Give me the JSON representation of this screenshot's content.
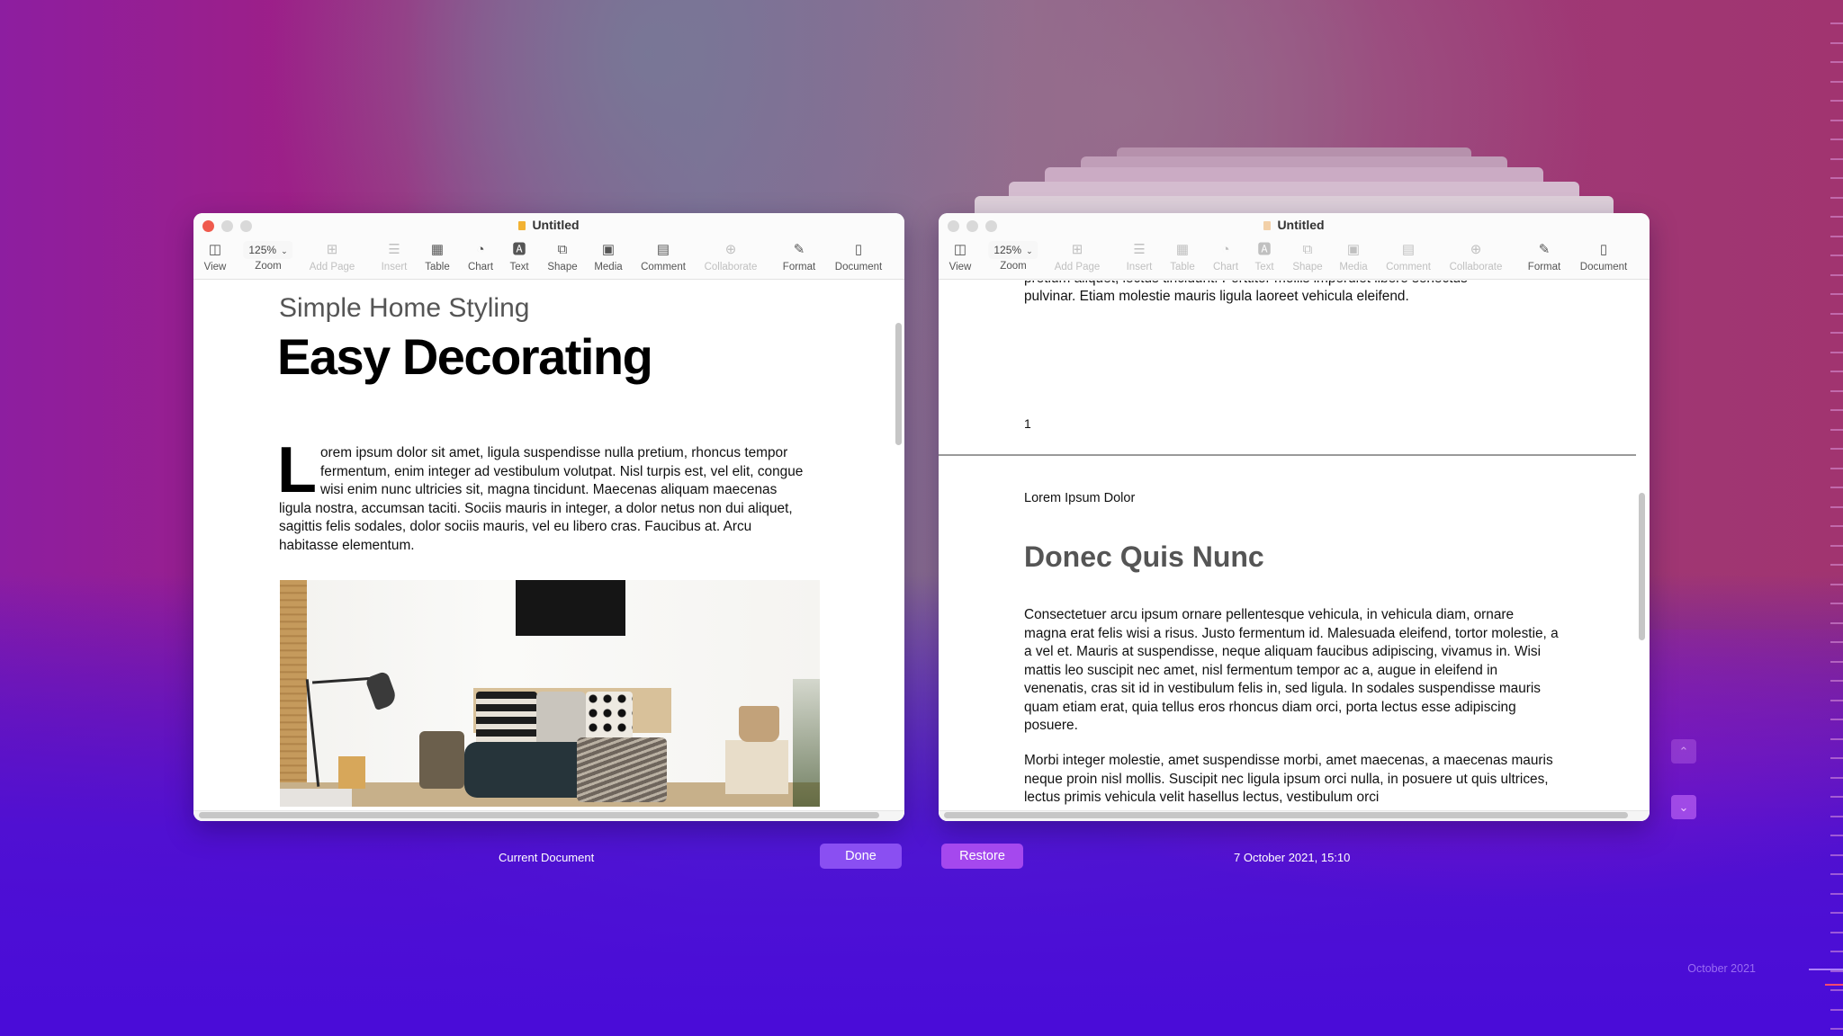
{
  "windows": {
    "current": {
      "title": "Untitled",
      "zoom_value": "125%",
      "toolbar": [
        {
          "id": "view",
          "label": "View",
          "icon": "sidebar-icon",
          "glyph": "◫",
          "enabled": true
        },
        {
          "id": "zoom",
          "label": "Zoom",
          "icon": "zoom-dropdown",
          "glyph": "",
          "enabled": true
        },
        {
          "id": "add-page",
          "label": "Add Page",
          "icon": "add-page-icon",
          "glyph": "⊞",
          "enabled": false
        },
        {
          "id": "insert",
          "label": "Insert",
          "icon": "insert-icon",
          "glyph": "☰",
          "enabled": false
        },
        {
          "id": "table",
          "label": "Table",
          "icon": "table-icon",
          "glyph": "▦",
          "enabled": true
        },
        {
          "id": "chart",
          "label": "Chart",
          "icon": "chart-icon",
          "glyph": "◔",
          "enabled": true
        },
        {
          "id": "text",
          "label": "Text",
          "icon": "text-box-icon",
          "glyph": "🅰",
          "enabled": true
        },
        {
          "id": "shape",
          "label": "Shape",
          "icon": "shape-icon",
          "glyph": "⧉",
          "enabled": true
        },
        {
          "id": "media",
          "label": "Media",
          "icon": "media-icon",
          "glyph": "▣",
          "enabled": true
        },
        {
          "id": "comment",
          "label": "Comment",
          "icon": "comment-icon",
          "glyph": "▤",
          "enabled": true
        },
        {
          "id": "collaborate",
          "label": "Collaborate",
          "icon": "collaborate-icon",
          "glyph": "⊕",
          "enabled": false
        },
        {
          "id": "format",
          "label": "Format",
          "icon": "format-brush-icon",
          "glyph": "✎",
          "enabled": true
        },
        {
          "id": "document",
          "label": "Document",
          "icon": "document-icon",
          "glyph": "▯",
          "enabled": true
        }
      ],
      "subtitle": "Simple Home Styling",
      "headline": "Easy Decorating",
      "dropcap": "L",
      "paragraph": "orem ipsum dolor sit amet, ligula suspendisse nulla pretium, rhoncus tempor fermentum, enim integer ad vestibulum volutpat. Nisl turpis est, vel elit, congue wisi enim nunc ultricies sit, magna tincidunt. Maecenas aliquam maecenas ligula nostra, accumsan taciti. Sociis mauris in integer, a dolor netus non dui aliquet, sagittis felis sodales, dolor sociis mauris, vel eu libero cras. Faucibus at. Arcu habitasse elementum.",
      "image_alt": "Living room with floor lamp, cushions and baskets"
    },
    "version": {
      "title": "Untitled",
      "zoom_value": "125%",
      "toolbar": [
        {
          "id": "view",
          "label": "View",
          "icon": "sidebar-icon",
          "glyph": "◫",
          "enabled": true
        },
        {
          "id": "zoom",
          "label": "Zoom",
          "icon": "zoom-dropdown",
          "glyph": "",
          "enabled": true
        },
        {
          "id": "add-page",
          "label": "Add Page",
          "icon": "add-page-icon",
          "glyph": "⊞",
          "enabled": false
        },
        {
          "id": "insert",
          "label": "Insert",
          "icon": "insert-icon",
          "glyph": "☰",
          "enabled": false
        },
        {
          "id": "table",
          "label": "Table",
          "icon": "table-icon",
          "glyph": "▦",
          "enabled": false
        },
        {
          "id": "chart",
          "label": "Chart",
          "icon": "chart-icon",
          "glyph": "◔",
          "enabled": false
        },
        {
          "id": "text",
          "label": "Text",
          "icon": "text-box-icon",
          "glyph": "🅰",
          "enabled": false
        },
        {
          "id": "shape",
          "label": "Shape",
          "icon": "shape-icon",
          "glyph": "⧉",
          "enabled": false
        },
        {
          "id": "media",
          "label": "Media",
          "icon": "media-icon",
          "glyph": "▣",
          "enabled": false
        },
        {
          "id": "comment",
          "label": "Comment",
          "icon": "comment-icon",
          "glyph": "▤",
          "enabled": false
        },
        {
          "id": "collaborate",
          "label": "Collaborate",
          "icon": "collaborate-icon",
          "glyph": "⊕",
          "enabled": false
        },
        {
          "id": "format",
          "label": "Format",
          "icon": "format-brush-icon",
          "glyph": "✎",
          "enabled": true
        },
        {
          "id": "document",
          "label": "Document",
          "icon": "document-icon",
          "glyph": "▯",
          "enabled": true
        }
      ],
      "partial_top_line": "pretium aliquet, lectus tincidunt. Porttitor mollis imperdiet libero senectus",
      "top_line": "pulvinar. Etiam molestie mauris ligula laoreet vehicula eleifend.",
      "page_number": "1",
      "header_text": "Lorem Ipsum Dolor",
      "section_title": "Donec Quis Nunc",
      "paragraph1": "Consectetuer arcu ipsum ornare pellentesque vehicula, in vehicula diam, ornare magna erat felis wisi a risus. Justo fermentum id. Malesuada eleifend, tortor molestie, a a vel et. Mauris at suspendisse, neque aliquam faucibus adipiscing, vivamus in. Wisi mattis leo suscipit nec amet, nisl fermentum tempor ac a, augue in eleifend in venenatis, cras sit id in vestibulum felis in, sed ligula. In sodales suspendisse mauris quam etiam erat, quia tellus eros rhoncus diam orci, porta lectus esse adipiscing posuere.",
      "paragraph2": "Morbi integer molestie, amet suspendisse morbi, amet maecenas, a maecenas mauris neque proin nisl mollis. Suscipit nec ligula ipsum orci nulla, in posuere ut quis ultrices, lectus primis vehicula velit hasellus lectus, vestibulum orci"
    }
  },
  "footer": {
    "current_label": "Current Document",
    "done_label": "Done",
    "restore_label": "Restore",
    "version_timestamp": "7 October 2021, 15:10"
  },
  "navigation": {
    "up_icon": "chevron-up-icon",
    "down_icon": "chevron-down-icon"
  },
  "timeline": {
    "label": "October 2021"
  },
  "colors": {
    "done_button": "#8a4ff2",
    "restore_button": "#a548ee",
    "timeline_current": "#ff4a6e",
    "close_button": "#ef5a4d"
  }
}
